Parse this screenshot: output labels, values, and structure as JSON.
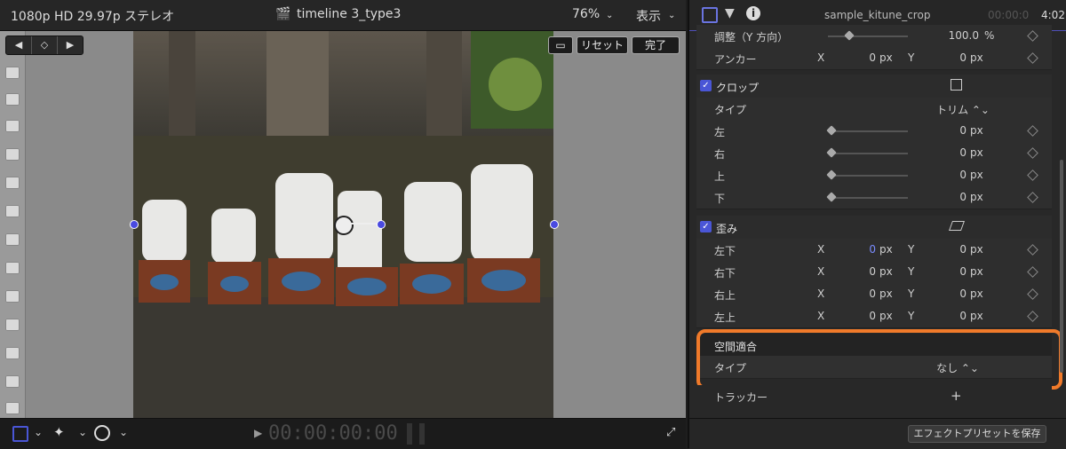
{
  "viewer": {
    "format": "1080p HD 29.97p ステレオ",
    "timeline_title": "timeline 3_type3",
    "zoom": "76%",
    "view_menu": "表示",
    "reset_label": "リセット",
    "done_label": "完了",
    "timecode": "00:00:00:00"
  },
  "inspector": {
    "clip_name": "sample_kitune_crop",
    "timecode_dim": "00:00:0",
    "timecode": "4:02",
    "rows": {
      "adjust_y": {
        "label": "調整（Y 方向）",
        "value": "100.0",
        "unit": "%"
      },
      "anchor": {
        "label": "アンカー",
        "x_axis": "X",
        "x_value": "0",
        "x_unit": "px",
        "y_axis": "Y",
        "y_value": "0",
        "y_unit": "px"
      },
      "crop": {
        "label": "クロップ"
      },
      "crop_type": {
        "label": "タイプ",
        "value": "トリム ⌃⌄"
      },
      "crop_left": {
        "label": "左",
        "value": "0",
        "unit": "px"
      },
      "crop_right": {
        "label": "右",
        "value": "0",
        "unit": "px"
      },
      "crop_top": {
        "label": "上",
        "value": "0",
        "unit": "px"
      },
      "crop_bottom": {
        "label": "下",
        "value": "0",
        "unit": "px"
      },
      "distort": {
        "label": "歪み"
      },
      "bl": {
        "label": "左下",
        "x_value": "0",
        "y_value": "0"
      },
      "br": {
        "label": "右下",
        "x_value": "0",
        "y_value": "0"
      },
      "tr": {
        "label": "右上",
        "x_value": "0",
        "y_value": "0"
      },
      "tl": {
        "label": "左上",
        "x_value": "0",
        "y_value": "0"
      },
      "spatial": {
        "label": "空間適合"
      },
      "spatial_type": {
        "label": "タイプ",
        "value": "なし ⌃⌄"
      },
      "tracker": {
        "label": "トラッカー",
        "add": "+"
      }
    },
    "axis_x": "X",
    "axis_y": "Y",
    "unit_px": "px",
    "preset_button": "エフェクトプリセットを保存"
  },
  "colors": {
    "accent": "#4a56d6",
    "highlight": "#f07a2a"
  }
}
